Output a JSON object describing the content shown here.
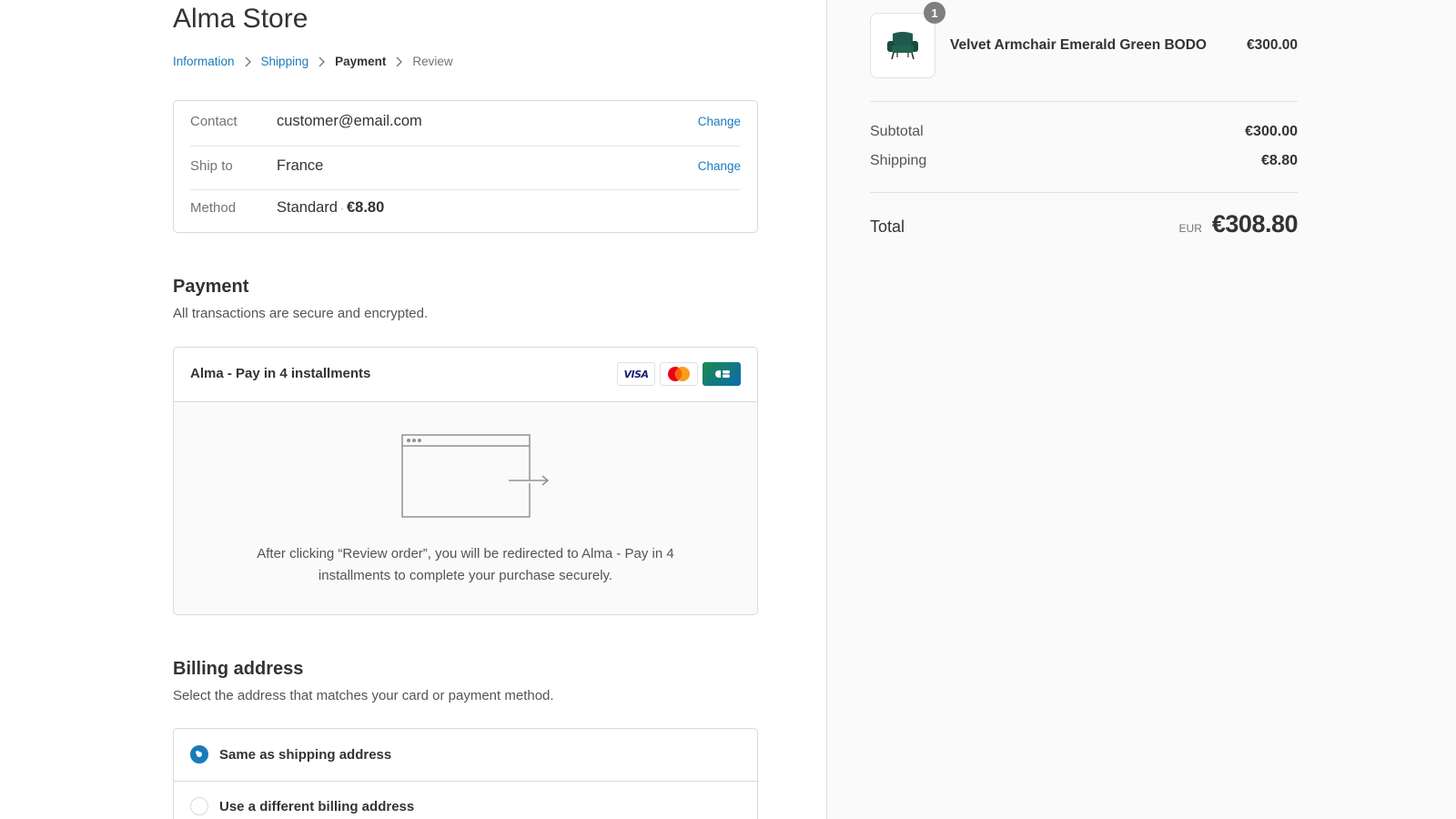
{
  "store": {
    "title": "Alma Store"
  },
  "breadcrumb": {
    "items": [
      {
        "label": "Information",
        "state": "link"
      },
      {
        "label": "Shipping",
        "state": "link"
      },
      {
        "label": "Payment",
        "state": "current"
      },
      {
        "label": "Review",
        "state": "pending"
      }
    ],
    "separator_icon": "chevron-right-icon"
  },
  "review": {
    "contact": {
      "label": "Contact",
      "value": "customer@email.com",
      "action": "Change"
    },
    "ship_to": {
      "label": "Ship to",
      "value": "France",
      "action": "Change"
    },
    "method": {
      "label": "Method",
      "value": "Standard",
      "separator": "·",
      "price": "€8.80"
    }
  },
  "payment": {
    "title": "Payment",
    "subtitle": "All transactions are secure and encrypted.",
    "option_name": "Alma - Pay in 4 installments",
    "card_icons": [
      {
        "icon": "visa-icon",
        "text": "VISA"
      },
      {
        "icon": "mastercard-icon"
      },
      {
        "icon": "carte-bancaire-icon"
      }
    ],
    "redirect_icon": "browser-redirect-icon",
    "redirect_text": "After clicking “Review order”, you will be redirected to Alma - Pay in 4 installments to complete your purchase securely."
  },
  "billing": {
    "title": "Billing address",
    "subtitle": "Select the address that matches your card or payment method.",
    "options": [
      {
        "label": "Same as shipping address",
        "checked": true
      },
      {
        "label": "Use a different billing address",
        "checked": false
      }
    ]
  },
  "order_summary": {
    "product": {
      "name": "Velvet Armchair Emerald Green BODO",
      "price": "€300.00",
      "quantity": "1",
      "image_icon": "armchair-icon"
    },
    "subtotal_label": "Subtotal",
    "subtotal_value": "€300.00",
    "shipping_label": "Shipping",
    "shipping_value": "€8.80",
    "total_label": "Total",
    "total_currency": "EUR",
    "total_value": "€308.80"
  },
  "colors": {
    "accent": "#197bbd",
    "text": "#333333",
    "muted": "#737373",
    "border": "#d9d9d9",
    "sidebar_bg": "#fafafa",
    "product_green": "#1f5b4d"
  }
}
